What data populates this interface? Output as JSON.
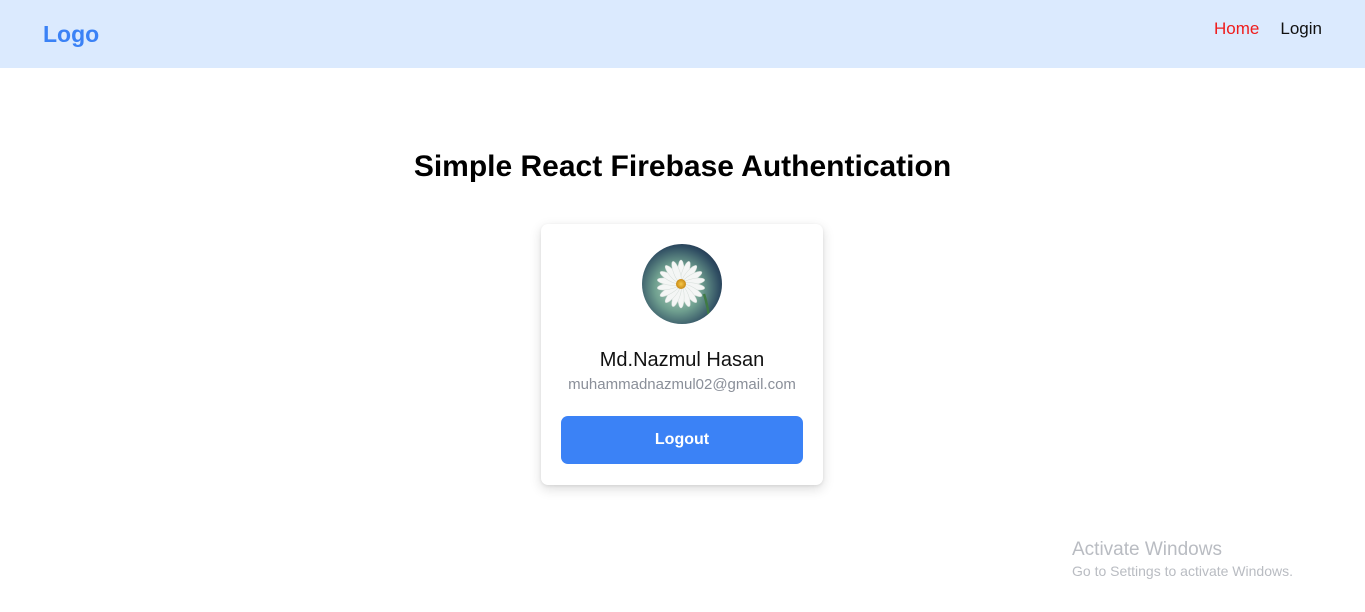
{
  "navbar": {
    "logo": "Logo",
    "links": [
      {
        "label": "Home",
        "active": true
      },
      {
        "label": "Login",
        "active": false
      }
    ]
  },
  "main": {
    "title": "Simple React Firebase Authentication"
  },
  "profile_card": {
    "avatar_icon": "daisy-flower-avatar",
    "name": "Md.Nazmul Hasan",
    "email": "muhammadnazmul02@gmail.com",
    "logout_label": "Logout"
  },
  "watermark": {
    "title": "Activate Windows",
    "subtitle": "Go to Settings to activate Windows."
  },
  "colors": {
    "navbar_bg": "#dbeafe",
    "accent": "#3b82f6",
    "active_link": "#ef1c1c"
  }
}
